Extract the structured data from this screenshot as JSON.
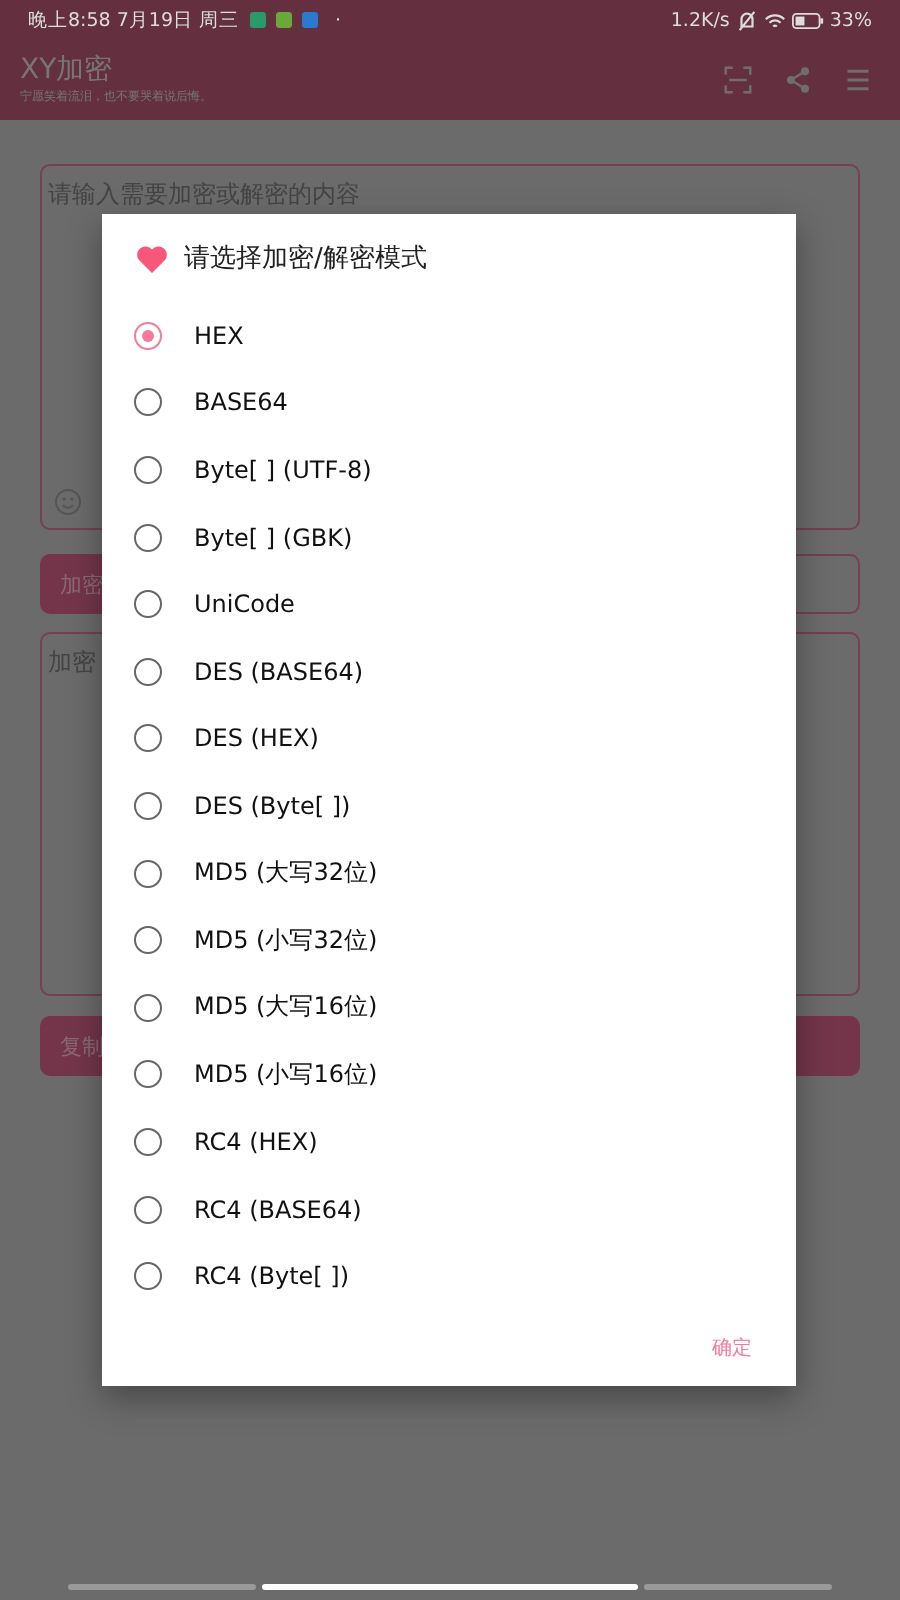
{
  "status_bar": {
    "time": "晚上8:58 7月19日 周三",
    "dot": "·",
    "net_speed": "1.2K/s",
    "battery": "33%"
  },
  "app_bar": {
    "title": "XY加密",
    "subtitle": "宁愿笑着流泪，也不要哭着说后悔。"
  },
  "input": {
    "placeholder": "请输入需要加密或解密的内容"
  },
  "encrypt_button": "加密",
  "output": {
    "placeholder": "加密"
  },
  "copy_button": "复制",
  "dialog": {
    "title": "请选择加密/解密模式",
    "options": [
      {
        "label": "HEX",
        "selected": true
      },
      {
        "label": "BASE64",
        "selected": false
      },
      {
        "label": "Byte[ ] (UTF-8)",
        "selected": false
      },
      {
        "label": "Byte[ ] (GBK)",
        "selected": false
      },
      {
        "label": "UniCode",
        "selected": false
      },
      {
        "label": "DES (BASE64)",
        "selected": false
      },
      {
        "label": "DES (HEX)",
        "selected": false
      },
      {
        "label": "DES (Byte[ ])",
        "selected": false
      },
      {
        "label": "MD5 (大写32位)",
        "selected": false
      },
      {
        "label": "MD5 (小写32位)",
        "selected": false
      },
      {
        "label": "MD5 (大写16位)",
        "selected": false
      },
      {
        "label": "MD5 (小写16位)",
        "selected": false
      },
      {
        "label": "RC4 (HEX)",
        "selected": false
      },
      {
        "label": "RC4 (BASE64)",
        "selected": false
      },
      {
        "label": "RC4 (Byte[ ])",
        "selected": false
      }
    ],
    "confirm": "确定"
  }
}
